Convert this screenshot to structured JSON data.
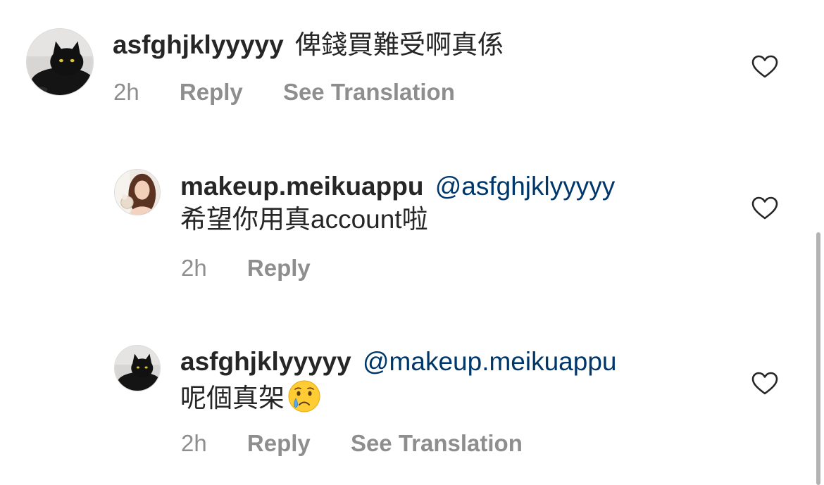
{
  "comments": [
    {
      "username": "asfghjklyyyyy",
      "mention": "",
      "text": "俾錢買難受啊真係",
      "time": "2h",
      "reply_label": "Reply",
      "translate_label": "See Translation",
      "avatar_icon": "black-cat-avatar"
    },
    {
      "username": "makeup.meikuappu",
      "mention": "@asfghjklyyyyy",
      "text": "希望你用真account啦",
      "time": "2h",
      "reply_label": "Reply",
      "translate_label": "",
      "avatar_icon": "woman-avatar"
    },
    {
      "username": "asfghjklyyyyy",
      "mention": "@makeup.meikuappu",
      "text": "呢個真架",
      "emoji": "crying-face-emoji",
      "time": "2h",
      "reply_label": "Reply",
      "translate_label": "See Translation",
      "avatar_icon": "black-cat-avatar"
    }
  ],
  "colors": {
    "text": "#262626",
    "secondary": "#8e8e8e",
    "mention": "#00376b",
    "scrollbar": "#b3b3b3"
  },
  "icons": {
    "like": "heart-outline-icon"
  }
}
